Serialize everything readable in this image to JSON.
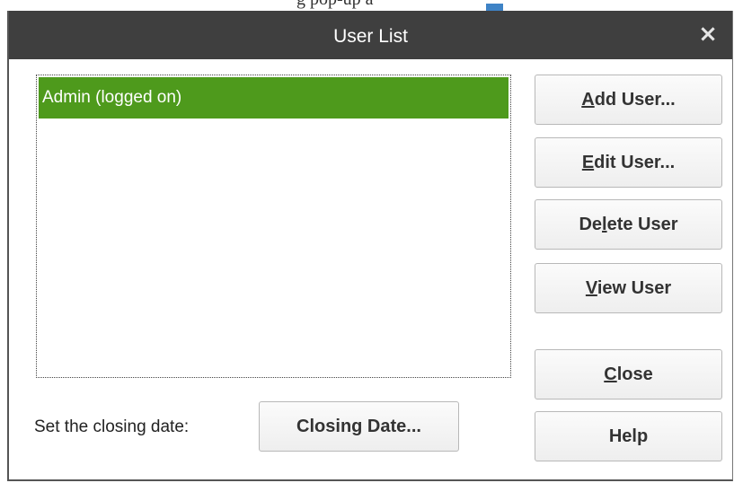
{
  "background_window": {
    "text": "g pop-up a"
  },
  "dialog": {
    "title": "User List",
    "close_glyph": "×",
    "close_icon": "close-icon"
  },
  "user_list": {
    "items": [
      {
        "label": "Admin (logged on)",
        "selected": true
      }
    ],
    "selected_color": "#4e9a1c"
  },
  "buttons": {
    "add_user": {
      "mnemonic": "A",
      "rest": "dd User..."
    },
    "edit_user": {
      "mnemonic": "E",
      "rest": "dit User..."
    },
    "delete_user": {
      "pre": "De",
      "mnemonic": "l",
      "rest": "ete User"
    },
    "view_user": {
      "mnemonic": "V",
      "rest": "iew User"
    },
    "close": {
      "mnemonic": "C",
      "rest": "lose"
    },
    "help": {
      "label": "Help"
    },
    "closing_date": {
      "label": "Closing Date..."
    }
  },
  "closing_date_label": "Set the closing date:"
}
